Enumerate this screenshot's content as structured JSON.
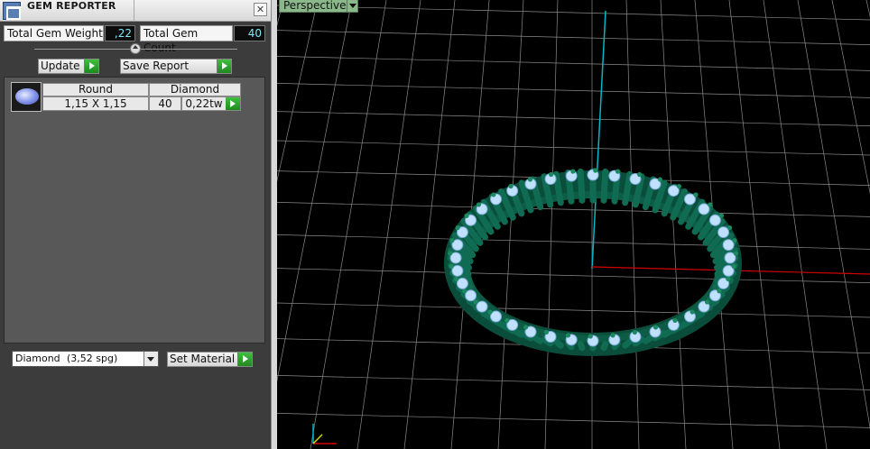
{
  "window": {
    "title": "GEM REPORTER",
    "close_glyph": "✕"
  },
  "totals": {
    "weight_label": "Total Gem Weight",
    "weight_value": ",22",
    "count_label": "Total Gem Count",
    "count_value": "40"
  },
  "buttons": {
    "update": "Update",
    "save_report": "Save Report",
    "set_material": "Set Material"
  },
  "gem_list": {
    "header": [
      "Round",
      "Diamond"
    ],
    "rows": [
      {
        "size": "1,15 X 1,15",
        "count": "40",
        "weight": "0,22tw"
      }
    ]
  },
  "material": {
    "name": "Diamond",
    "sg": "(3,52 spg)"
  },
  "viewport": {
    "label": "Perspective"
  },
  "colors": {
    "ring": "#0f6b52",
    "gem": "#bfe0ff",
    "axis_x": "#d40000",
    "axis_y": "#00b8c8",
    "grid": "#8a8a8a"
  }
}
